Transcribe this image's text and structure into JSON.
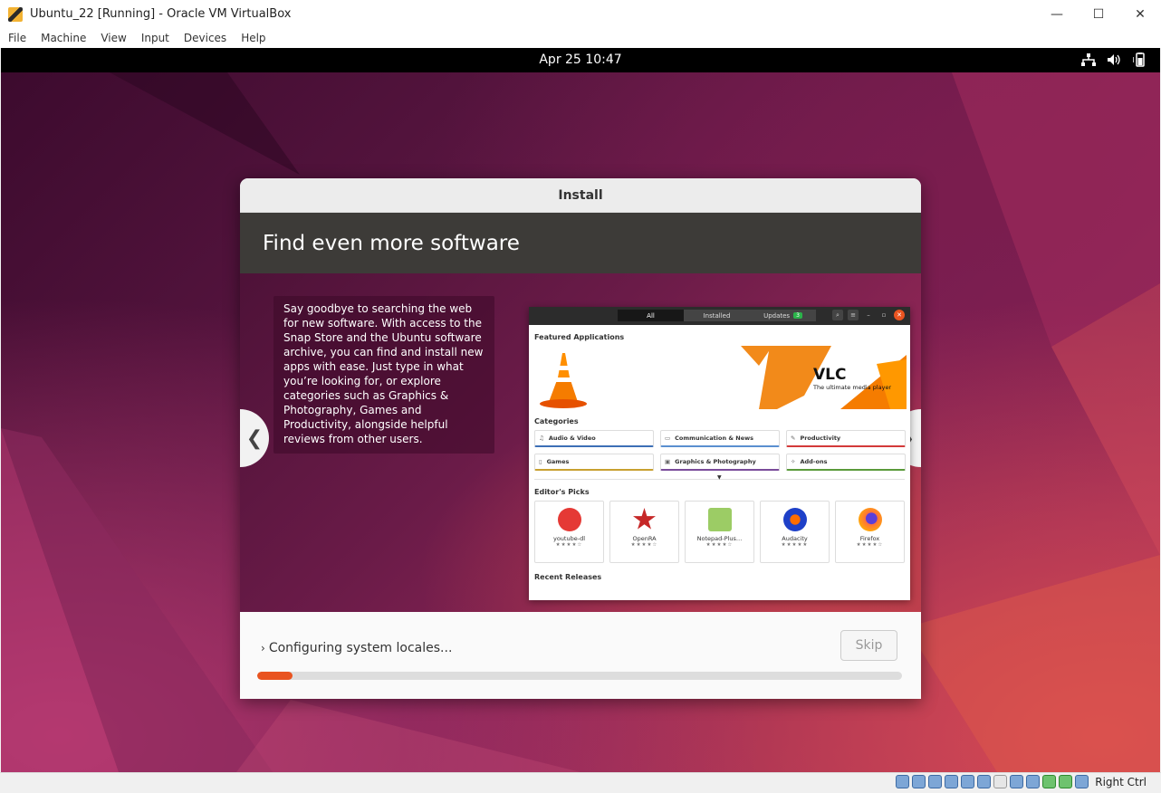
{
  "host": {
    "window_title": "Ubuntu_22 [Running] - Oracle VM VirtualBox",
    "menu": [
      "File",
      "Machine",
      "View",
      "Input",
      "Devices",
      "Help"
    ],
    "host_key_label": "Right Ctrl"
  },
  "guest": {
    "clock": "Apr 25  10:47",
    "tray_icons": [
      "network-icon",
      "volume-icon",
      "battery-icon"
    ]
  },
  "installer": {
    "title": "Install",
    "slide": {
      "heading": "Find even more software",
      "text": "Say goodbye to searching the web for new software. With access to the Snap Store and the Ubuntu software archive, you can find and install new apps with ease. Just type in what you’re looking for, or explore categories such as Graphics & Photography, Games and Productivity, alongside helpful reviews from other users.",
      "prev_label": "❮",
      "next_label": "❯"
    },
    "software_center": {
      "tabs": [
        "All",
        "Installed",
        "Updates"
      ],
      "updates_count": "3",
      "featured_heading": "Featured Applications",
      "featured_app": "VLC",
      "featured_tagline": "The ultimate media player",
      "categories_heading": "Categories",
      "categories": [
        {
          "label": "Audio & Video",
          "color": "#3d6fb6"
        },
        {
          "label": "Communication & News",
          "color": "#5a8fd0"
        },
        {
          "label": "Productivity",
          "color": "#d33a3a"
        },
        {
          "label": "Games",
          "color": "#c8a030"
        },
        {
          "label": "Graphics & Photography",
          "color": "#7a4b9a"
        },
        {
          "label": "Add-ons",
          "color": "#5a9a3a"
        }
      ],
      "editors_heading": "Editor's Picks",
      "picks": [
        {
          "name": "youtube-dl",
          "stars": "★★★★☆",
          "color": "#e53935"
        },
        {
          "name": "OpenRA",
          "stars": "★★★★☆",
          "color": "#c62828"
        },
        {
          "name": "Notepad-Plus…",
          "stars": "★★★★☆",
          "color": "#7cb342"
        },
        {
          "name": "Audacity",
          "stars": "★★★★★",
          "color": "#1e40c8"
        },
        {
          "name": "Firefox",
          "stars": "★★★★☆",
          "color": "#ff7139"
        }
      ],
      "recent_heading": "Recent Releases"
    },
    "status_text": "Configuring system locales...",
    "skip_label": "Skip",
    "progress": 0.055
  }
}
